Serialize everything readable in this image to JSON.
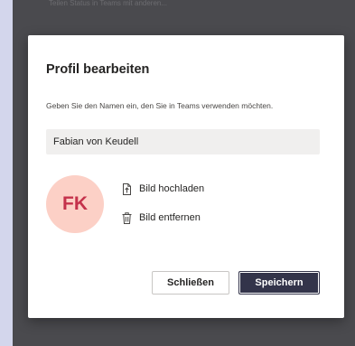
{
  "backdrop": {
    "text": "Teilen Status in Teams mit anderen..."
  },
  "dialog": {
    "title": "Profil bearbeiten",
    "description": "Geben Sie den Namen ein, den Sie in Teams verwenden möchten.",
    "name_value": "Fabian von Keudell",
    "avatar_initials": "FK",
    "upload_label": "Bild hochladen",
    "remove_label": "Bild entfernen",
    "close_label": "Schließen",
    "save_label": "Speichern"
  },
  "icons": {
    "upload": "upload-image-icon",
    "remove": "trash-icon"
  },
  "colors": {
    "avatar_bg": "#fcd0c6",
    "avatar_text": "#c4314b",
    "primary_button": "#33344a",
    "input_bg": "#f0efee"
  }
}
